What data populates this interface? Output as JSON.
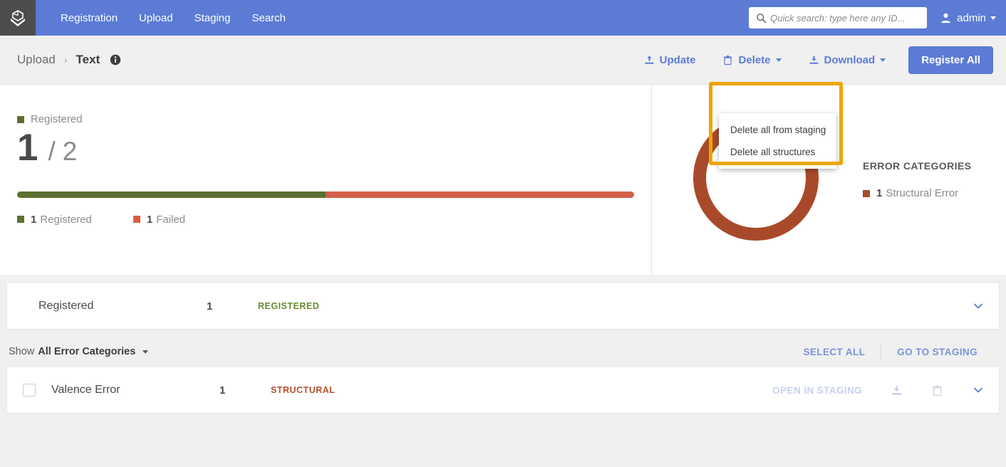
{
  "navbar": {
    "logo_icon": "cube-download-logo-icon",
    "links": [
      {
        "label": "Registration"
      },
      {
        "label": "Upload"
      },
      {
        "label": "Staging"
      },
      {
        "label": "Search"
      }
    ],
    "search": {
      "icon": "search-icon",
      "placeholder": "Quick search: type here any ID...",
      "value": ""
    },
    "user": {
      "icon": "user-avatar-icon",
      "label": "admin"
    },
    "background_color": "#5b7bd5"
  },
  "breadcrumb": {
    "parent": "Upload",
    "separator": "›",
    "current": "Text",
    "info_icon": "info-circle-icon"
  },
  "toolbar": {
    "update": {
      "label": "Update",
      "icon": "upload-icon"
    },
    "delete": {
      "label": "Delete",
      "icon": "trash-icon",
      "expanded": true
    },
    "download": {
      "label": "Download",
      "icon": "download-icon"
    },
    "register_all": {
      "label": "Register All"
    },
    "accent_color": "#5b7bd5"
  },
  "delete_dropdown": {
    "items": [
      {
        "label": "Delete all from staging"
      },
      {
        "label": "Delete all structures"
      }
    ],
    "highlight_color": "#eda600"
  },
  "summary": {
    "status_label": "Registered",
    "registered_count": "1",
    "separator": "/",
    "total_count": "2",
    "legend": [
      {
        "count": "1",
        "label": "Registered",
        "color": "#5c7030"
      },
      {
        "count": "1",
        "label": "Failed",
        "color": "#dd5c44"
      }
    ],
    "error_panel": {
      "title": "ERROR CATEGORIES",
      "items": [
        {
          "count": "1",
          "label": "Structural Error",
          "color": "#a84a2a"
        }
      ]
    }
  },
  "chart_data": {
    "type": "pie",
    "title": "ERROR CATEGORIES",
    "labels": [
      "Structural Error"
    ],
    "values": [
      1
    ],
    "colors": [
      "#a84a2a"
    ],
    "donut": true,
    "legend_position": "right",
    "progress_bar": {
      "type": "bar",
      "categories": [
        "Registered",
        "Failed"
      ],
      "values": [
        1,
        1
      ],
      "colors": [
        "#5c7030",
        "#d2604a"
      ],
      "total": 2
    }
  },
  "registered_row": {
    "name": "Registered",
    "count": "1",
    "tag": "REGISTERED",
    "chevron_icon": "chevron-down-icon"
  },
  "filter_bar": {
    "show_label": "Show",
    "filter_value": "All Error Categories",
    "select_all": "SELECT ALL",
    "go_to_staging": "GO TO STAGING"
  },
  "error_row": {
    "checkbox_checked": false,
    "name": "Valence Error",
    "count": "1",
    "tag": "STRUCTURAL",
    "open_in_staging": "OPEN IN STAGING",
    "download_icon": "download-icon",
    "delete_icon": "trash-icon",
    "chevron_icon": "chevron-down-icon"
  }
}
